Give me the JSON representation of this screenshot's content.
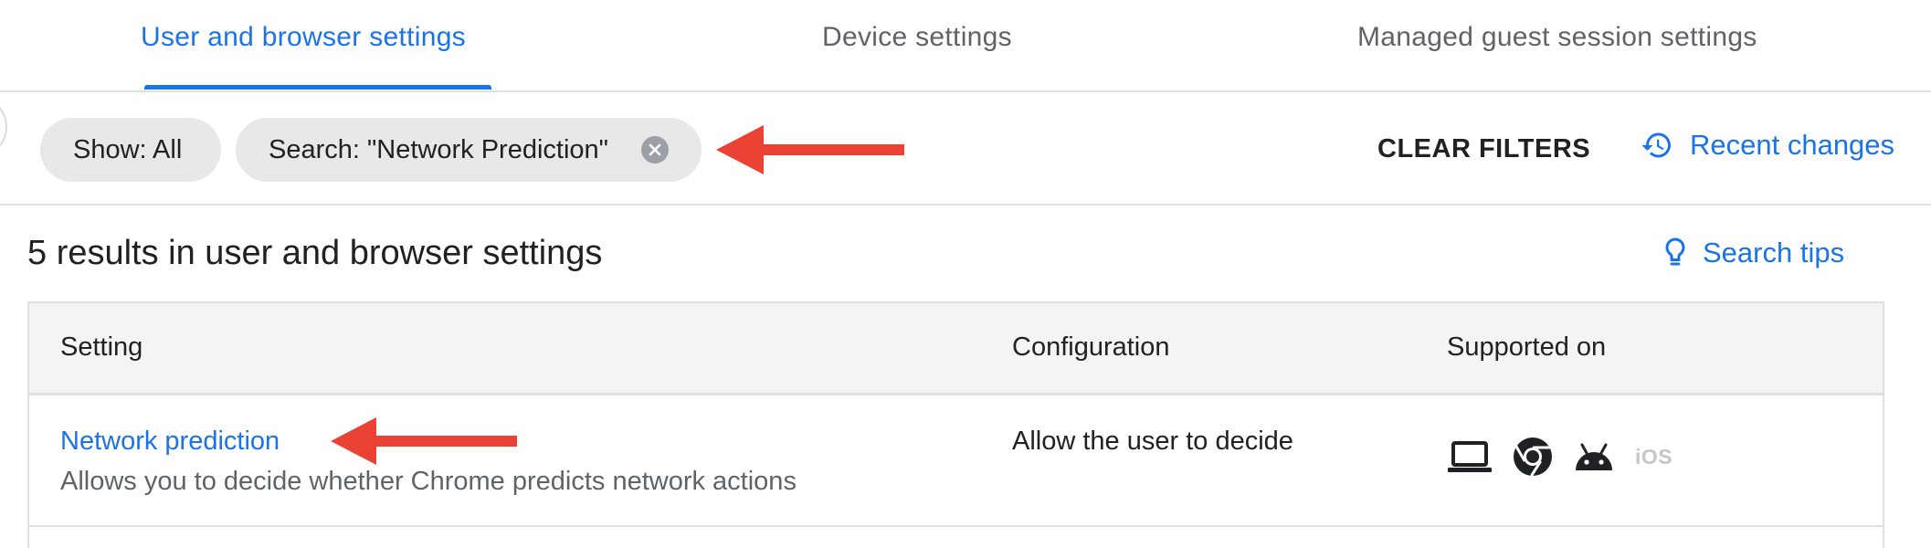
{
  "tabs": [
    {
      "label": "User and browser settings",
      "active": true
    },
    {
      "label": "Device settings",
      "active": false
    },
    {
      "label": "Managed guest session settings",
      "active": false
    }
  ],
  "filters": {
    "chips": [
      {
        "label": "Show: All"
      },
      {
        "label": "Search: \"Network Prediction\"",
        "removable": true
      }
    ],
    "clear_label": "CLEAR FILTERS",
    "recent_changes_label": "Recent changes",
    "recent_changes_icon": "history-icon",
    "chip_close_icon": "close-circle-icon"
  },
  "results": {
    "title": "5 results in user and browser settings",
    "search_tips_label": "Search tips",
    "search_tips_icon": "lightbulb-icon"
  },
  "table": {
    "columns": [
      "Setting",
      "Configuration",
      "Supported on"
    ],
    "rows": [
      {
        "setting": "Network prediction",
        "description": "Allows you to decide whether Chrome predicts network actions",
        "configuration": "Allow the user to decide",
        "platforms": [
          {
            "icon": "laptop-icon",
            "supported": true
          },
          {
            "icon": "chrome-icon",
            "supported": true
          },
          {
            "icon": "android-icon",
            "supported": true
          },
          {
            "icon": "ios-icon",
            "label": "iOS",
            "supported": false
          }
        ]
      }
    ]
  },
  "annotations": {
    "arrow_color": "#ea4335"
  },
  "colors": {
    "accent": "#1a73e8",
    "chip_bg": "#e8e8e8",
    "header_bg": "#f4f4f4"
  }
}
